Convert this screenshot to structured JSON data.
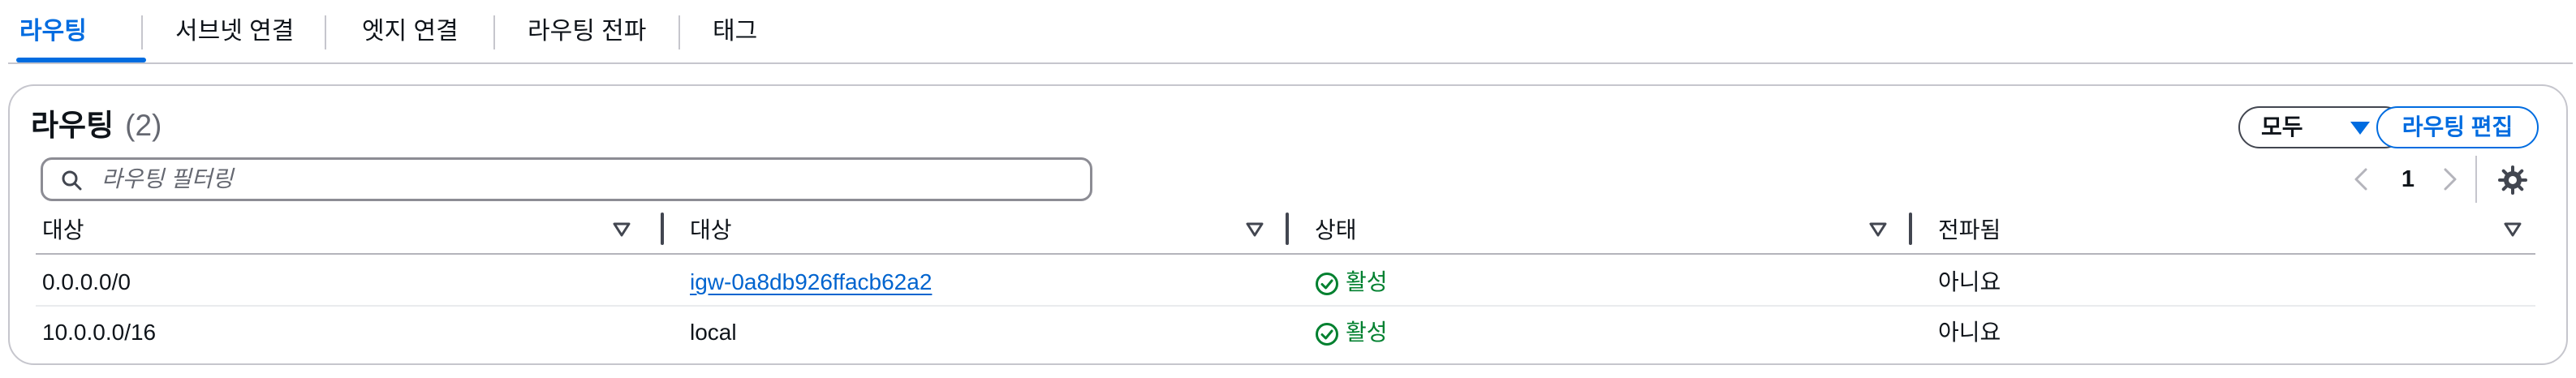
{
  "tabs": [
    {
      "label": "라우팅",
      "active": true
    },
    {
      "label": "서브넷 연결",
      "active": false
    },
    {
      "label": "엣지 연결",
      "active": false
    },
    {
      "label": "라우팅 전파",
      "active": false
    },
    {
      "label": "태그",
      "active": false
    }
  ],
  "routes": {
    "title": "라우팅",
    "count": "(2)",
    "filter_button": "모두",
    "edit_button": "라우팅 편집",
    "search_placeholder": "라우팅 필터링",
    "page": "1"
  },
  "table": {
    "columns": [
      "대상",
      "대상",
      "상태",
      "전파됨"
    ],
    "rows": [
      {
        "destination": "0.0.0.0/0",
        "target": "igw-0a8db926ffacb62a2",
        "target_is_link": true,
        "status": "활성",
        "propagated": "아니요"
      },
      {
        "destination": "10.0.0.0/16",
        "target": "local",
        "target_is_link": false,
        "status": "활성",
        "propagated": "아니요"
      }
    ]
  },
  "colors": {
    "accent": "#006ce0",
    "link": "#0064cf",
    "success": "#00802f"
  },
  "icons": {
    "search": "search-icon",
    "prev": "chevron-left-icon",
    "next": "chevron-right-icon",
    "settings": "gear-icon",
    "sort": "sort-triangle-icon",
    "status": "check-circle-icon",
    "dropdown": "caret-down-icon"
  }
}
